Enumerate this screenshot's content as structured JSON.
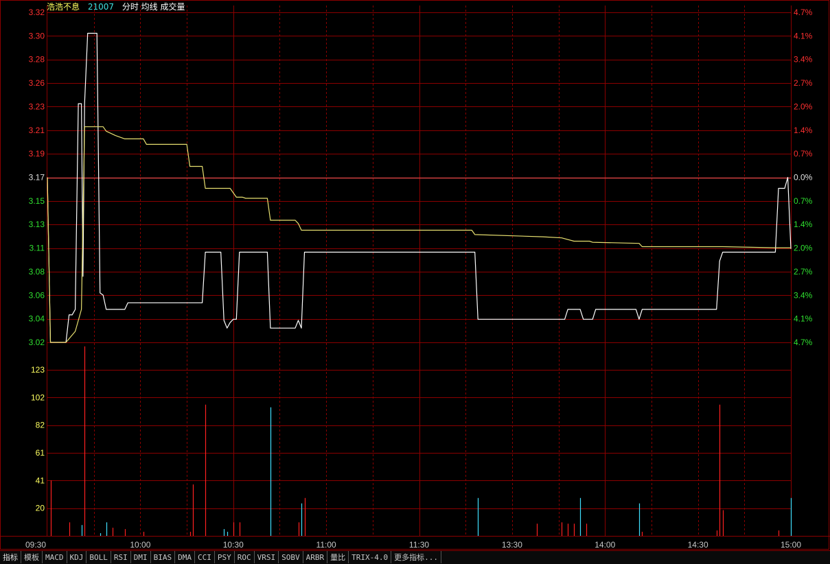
{
  "header": {
    "name": "浩浩不息",
    "code": "21007",
    "labels": "分时 均线 成交量"
  },
  "colors": {
    "background": "#000000",
    "grid": "#8b0000",
    "up": "#ff3030",
    "down": "#30e030",
    "neutral": "#e0e0e0",
    "price_line": "#ffffff",
    "avg_line": "#e8e070",
    "vol_up": "#ff2020",
    "vol_down": "#40e0ff",
    "header_name": "#ffff60",
    "header_code": "#40e0e0",
    "header_labels": "#ffffff"
  },
  "chart_data": {
    "type": "line",
    "prev_close": 3.17,
    "price_axis": {
      "ylim": [
        3.02,
        3.32
      ],
      "ticks": [
        "3.32",
        "3.30",
        "3.28",
        "3.26",
        "3.23",
        "3.21",
        "3.19",
        "3.17",
        "3.15",
        "3.13",
        "3.11",
        "3.08",
        "3.06",
        "3.04",
        "3.02"
      ],
      "pct_ticks": [
        "4.7%",
        "4.1%",
        "3.4%",
        "2.7%",
        "2.0%",
        "1.4%",
        "0.7%",
        "0.0%",
        "0.7%",
        "1.4%",
        "2.0%",
        "2.7%",
        "3.4%",
        "4.1%",
        "4.7%"
      ]
    },
    "volume_axis": {
      "ylim": [
        0,
        143
      ],
      "ticks": [
        "123",
        "102",
        "82",
        "61",
        "41",
        "20"
      ]
    },
    "time_axis": {
      "labels": [
        "09:30",
        "10:00",
        "10:30",
        "11:00",
        "11:30",
        "13:30",
        "14:00",
        "14:30",
        "15:00"
      ],
      "minutes": [
        0,
        30,
        60,
        90,
        120,
        150,
        180,
        210,
        240
      ]
    },
    "series": [
      {
        "key": "price",
        "points": [
          [
            0,
            3.17
          ],
          [
            1,
            3.02
          ],
          [
            6,
            3.02
          ],
          [
            7,
            3.045
          ],
          [
            8,
            3.045
          ],
          [
            9,
            3.05
          ],
          [
            10,
            3.237
          ],
          [
            11,
            3.237
          ],
          [
            11.5,
            3.08
          ],
          [
            12,
            3.237
          ],
          [
            13,
            3.301
          ],
          [
            16,
            3.301
          ],
          [
            17,
            3.065
          ],
          [
            18,
            3.063
          ],
          [
            19,
            3.05
          ],
          [
            25,
            3.05
          ],
          [
            26,
            3.056
          ],
          [
            50,
            3.056
          ],
          [
            51,
            3.102
          ],
          [
            56,
            3.102
          ],
          [
            57,
            3.04
          ],
          [
            58,
            3.033
          ],
          [
            59,
            3.038
          ],
          [
            60,
            3.041
          ],
          [
            61,
            3.041
          ],
          [
            62,
            3.102
          ],
          [
            71,
            3.102
          ],
          [
            72,
            3.033
          ],
          [
            80,
            3.033
          ],
          [
            81,
            3.04
          ],
          [
            82,
            3.033
          ],
          [
            83,
            3.102
          ],
          [
            138,
            3.102
          ],
          [
            139,
            3.041
          ],
          [
            167,
            3.041
          ],
          [
            168,
            3.05
          ],
          [
            172,
            3.05
          ],
          [
            173,
            3.041
          ],
          [
            176,
            3.041
          ],
          [
            177,
            3.05
          ],
          [
            190,
            3.05
          ],
          [
            191,
            3.041
          ],
          [
            192,
            3.05
          ],
          [
            216,
            3.05
          ],
          [
            217,
            3.094
          ],
          [
            218,
            3.102
          ],
          [
            235,
            3.102
          ],
          [
            236,
            3.16
          ],
          [
            238,
            3.16
          ],
          [
            239,
            3.17
          ],
          [
            240,
            3.105
          ]
        ]
      },
      {
        "key": "avg",
        "points": [
          [
            0,
            3.17
          ],
          [
            1,
            3.02
          ],
          [
            6,
            3.02
          ],
          [
            9,
            3.03
          ],
          [
            11,
            3.05
          ],
          [
            12,
            3.216
          ],
          [
            18,
            3.216
          ],
          [
            19,
            3.212
          ],
          [
            22,
            3.208
          ],
          [
            25,
            3.205
          ],
          [
            31,
            3.205
          ],
          [
            32,
            3.2
          ],
          [
            45,
            3.2
          ],
          [
            46,
            3.18
          ],
          [
            50,
            3.18
          ],
          [
            51,
            3.16
          ],
          [
            59,
            3.16
          ],
          [
            61,
            3.152
          ],
          [
            63,
            3.152
          ],
          [
            64,
            3.151
          ],
          [
            71,
            3.151
          ],
          [
            72,
            3.131
          ],
          [
            80,
            3.131
          ],
          [
            81,
            3.128
          ],
          [
            82,
            3.122
          ],
          [
            86,
            3.122
          ],
          [
            137,
            3.122
          ],
          [
            138,
            3.118
          ],
          [
            160,
            3.116
          ],
          [
            166,
            3.115
          ],
          [
            170,
            3.112
          ],
          [
            175,
            3.112
          ],
          [
            176,
            3.111
          ],
          [
            191,
            3.11
          ],
          [
            192,
            3.107
          ],
          [
            218,
            3.107
          ],
          [
            235,
            3.106
          ],
          [
            240,
            3.106
          ]
        ]
      }
    ],
    "volume": [
      {
        "t": 1,
        "v": 41,
        "dir": "up"
      },
      {
        "t": 7,
        "v": 10,
        "dir": "up"
      },
      {
        "t": 11,
        "v": 8,
        "dir": "down"
      },
      {
        "t": 12,
        "v": 140,
        "dir": "up"
      },
      {
        "t": 17,
        "v": 2,
        "dir": "down"
      },
      {
        "t": 19,
        "v": 10,
        "dir": "down"
      },
      {
        "t": 21,
        "v": 6,
        "dir": "up"
      },
      {
        "t": 25,
        "v": 5,
        "dir": "up"
      },
      {
        "t": 31,
        "v": 3,
        "dir": "up"
      },
      {
        "t": 46,
        "v": 3,
        "dir": "up"
      },
      {
        "t": 47,
        "v": 38,
        "dir": "up"
      },
      {
        "t": 51,
        "v": 97,
        "dir": "up"
      },
      {
        "t": 57,
        "v": 5,
        "dir": "down"
      },
      {
        "t": 58,
        "v": 3,
        "dir": "down"
      },
      {
        "t": 60,
        "v": 10,
        "dir": "up"
      },
      {
        "t": 62,
        "v": 10,
        "dir": "up"
      },
      {
        "t": 72,
        "v": 95,
        "dir": "down"
      },
      {
        "t": 81,
        "v": 10,
        "dir": "up"
      },
      {
        "t": 82,
        "v": 24,
        "dir": "down"
      },
      {
        "t": 83,
        "v": 28,
        "dir": "up"
      },
      {
        "t": 139,
        "v": 28,
        "dir": "down"
      },
      {
        "t": 158,
        "v": 9,
        "dir": "up"
      },
      {
        "t": 166,
        "v": 10,
        "dir": "up"
      },
      {
        "t": 168,
        "v": 9,
        "dir": "up"
      },
      {
        "t": 170,
        "v": 9,
        "dir": "up"
      },
      {
        "t": 172,
        "v": 28,
        "dir": "down"
      },
      {
        "t": 174,
        "v": 9,
        "dir": "up"
      },
      {
        "t": 191,
        "v": 24,
        "dir": "down"
      },
      {
        "t": 192,
        "v": 3,
        "dir": "up"
      },
      {
        "t": 216,
        "v": 4,
        "dir": "up"
      },
      {
        "t": 217,
        "v": 97,
        "dir": "up"
      },
      {
        "t": 218,
        "v": 19,
        "dir": "up"
      },
      {
        "t": 236,
        "v": 4,
        "dir": "up"
      },
      {
        "t": 240,
        "v": 28,
        "dir": "down"
      }
    ]
  },
  "tabs": [
    "指标",
    "模板",
    "MACD",
    "KDJ",
    "BOLL",
    "RSI",
    "DMI",
    "BIAS",
    "DMA",
    "CCI",
    "PSY",
    "ROC",
    "VRSI",
    "SOBV",
    "ARBR",
    "量比",
    "TRIX-4.0",
    "更多指标..."
  ]
}
